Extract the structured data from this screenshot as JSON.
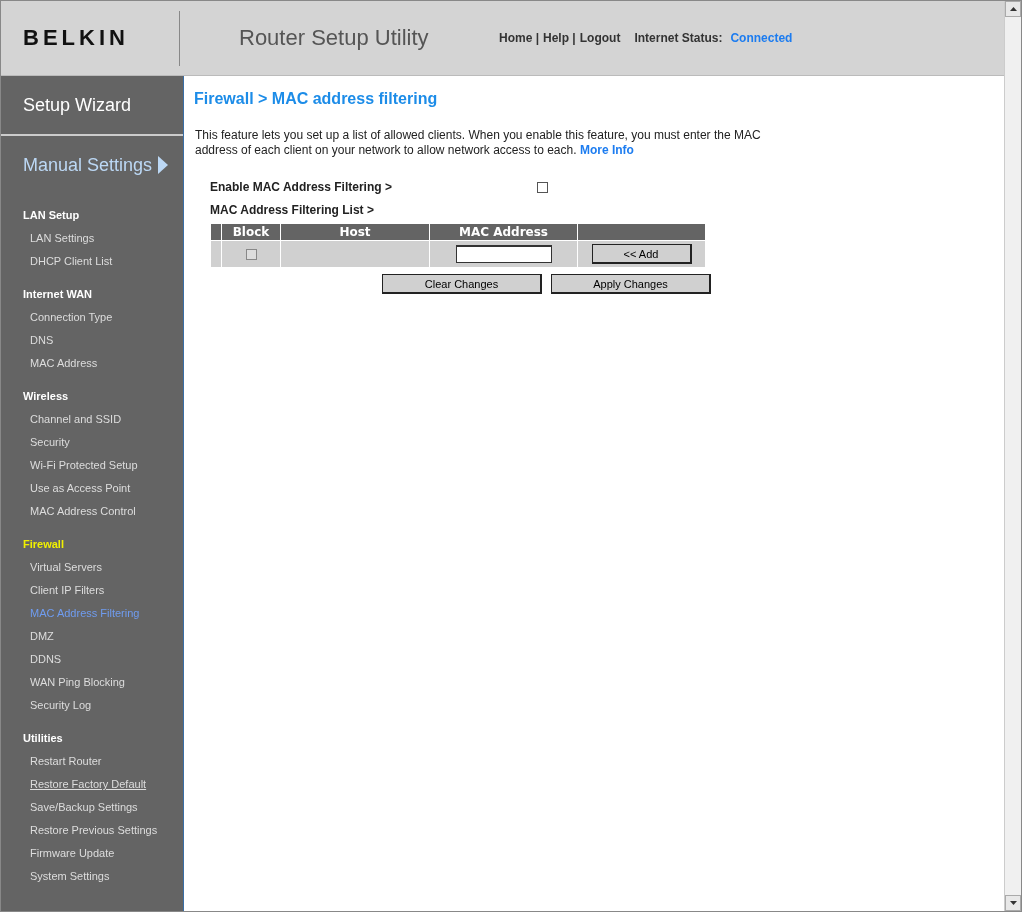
{
  "header": {
    "logo": "BELKIN",
    "title": "Router Setup Utility",
    "links": [
      "Home |",
      "Help |",
      "Logout"
    ],
    "status_label": "Internet Status:",
    "status_value": "Connected"
  },
  "sidebar": {
    "wizard": "Setup Wizard",
    "manual": "Manual Settings",
    "sections": [
      {
        "title": "LAN Setup",
        "active": false,
        "items": [
          {
            "label": "LAN Settings",
            "selected": false,
            "hovered": false
          },
          {
            "label": "DHCP Client List",
            "selected": false,
            "hovered": false
          }
        ]
      },
      {
        "title": "Internet WAN",
        "active": false,
        "items": [
          {
            "label": "Connection Type",
            "selected": false,
            "hovered": false
          },
          {
            "label": "DNS",
            "selected": false,
            "hovered": false
          },
          {
            "label": "MAC Address",
            "selected": false,
            "hovered": false
          }
        ]
      },
      {
        "title": "Wireless",
        "active": false,
        "items": [
          {
            "label": "Channel and SSID",
            "selected": false,
            "hovered": false
          },
          {
            "label": "Security",
            "selected": false,
            "hovered": false
          },
          {
            "label": "Wi-Fi Protected Setup",
            "selected": false,
            "hovered": false
          },
          {
            "label": "Use as Access Point",
            "selected": false,
            "hovered": false
          },
          {
            "label": "MAC Address Control",
            "selected": false,
            "hovered": false
          }
        ]
      },
      {
        "title": "Firewall",
        "active": true,
        "items": [
          {
            "label": "Virtual Servers",
            "selected": false,
            "hovered": false
          },
          {
            "label": "Client IP Filters",
            "selected": false,
            "hovered": false
          },
          {
            "label": "MAC Address Filtering",
            "selected": true,
            "hovered": false
          },
          {
            "label": "DMZ",
            "selected": false,
            "hovered": false
          },
          {
            "label": "DDNS",
            "selected": false,
            "hovered": false
          },
          {
            "label": "WAN Ping Blocking",
            "selected": false,
            "hovered": false
          },
          {
            "label": "Security Log",
            "selected": false,
            "hovered": false
          }
        ]
      },
      {
        "title": "Utilities",
        "active": false,
        "items": [
          {
            "label": "Restart Router",
            "selected": false,
            "hovered": false
          },
          {
            "label": "Restore Factory Default",
            "selected": false,
            "hovered": true
          },
          {
            "label": "Save/Backup Settings",
            "selected": false,
            "hovered": false
          },
          {
            "label": "Restore Previous Settings",
            "selected": false,
            "hovered": false
          },
          {
            "label": "Firmware Update",
            "selected": false,
            "hovered": false
          },
          {
            "label": "System Settings",
            "selected": false,
            "hovered": false
          }
        ]
      }
    ]
  },
  "main": {
    "heading": "Firewall > MAC address filtering",
    "description": "This feature lets you set up a list of allowed clients. When you enable this feature, you must enter the MAC address of each client on your network to allow network access to each.",
    "more_info": "More Info",
    "enable_label": "Enable MAC Address Filtering >",
    "enable_checked": false,
    "list_label": "MAC Address Filtering List >",
    "table": {
      "columns": [
        "Block",
        "Host",
        "MAC Address"
      ],
      "row": {
        "block_checked": false,
        "add_button": "<< Add"
      }
    },
    "buttons": [
      "Clear Changes",
      "Apply Changes"
    ]
  }
}
